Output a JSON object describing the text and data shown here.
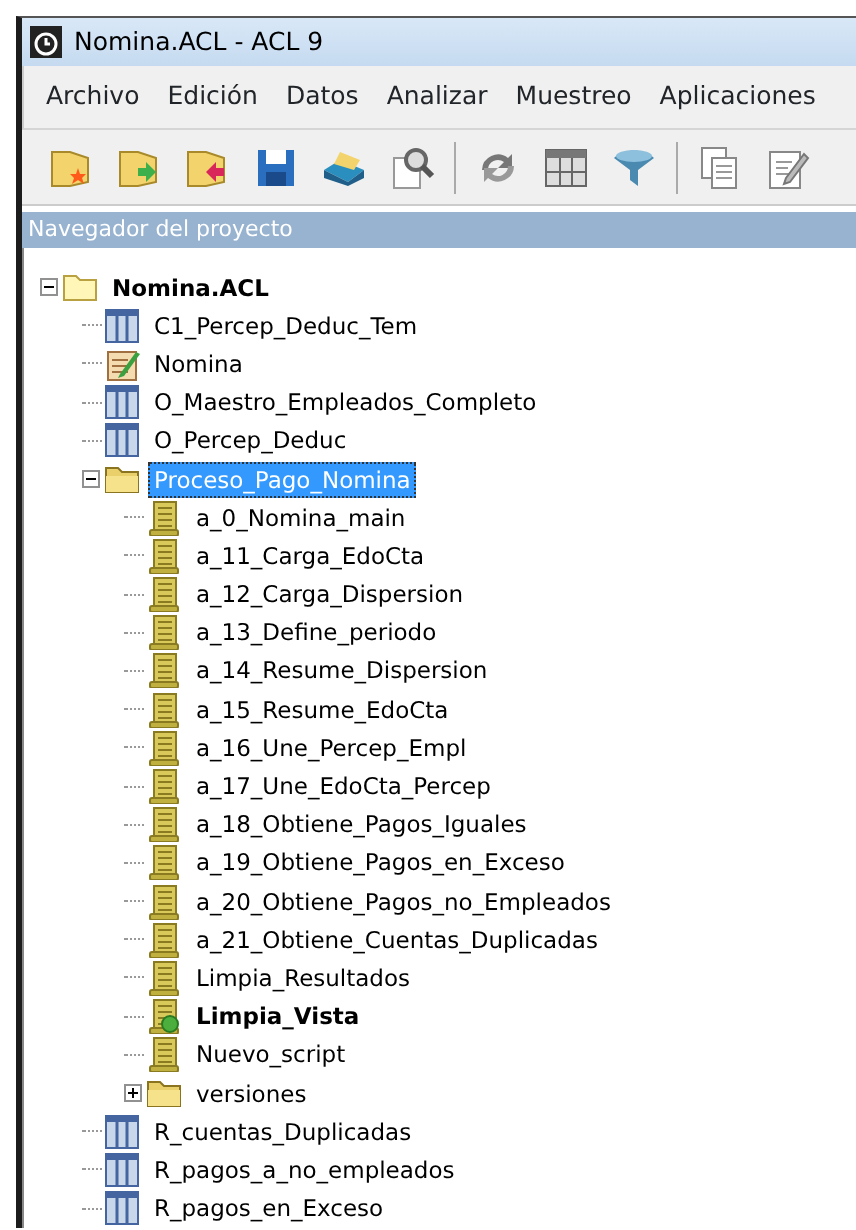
{
  "window": {
    "title": "Nomina.ACL - ACL 9"
  },
  "menu": [
    "Archivo",
    "Edición",
    "Datos",
    "Analizar",
    "Muestreo",
    "Aplicaciones"
  ],
  "toolbar": [
    {
      "kind": "new-project"
    },
    {
      "kind": "open-project"
    },
    {
      "kind": "close-project"
    },
    {
      "kind": "save"
    },
    {
      "kind": "print"
    },
    {
      "kind": "preview"
    },
    {
      "kind": "separator"
    },
    {
      "kind": "refresh"
    },
    {
      "kind": "table"
    },
    {
      "kind": "filter"
    },
    {
      "kind": "separator"
    },
    {
      "kind": "copy"
    },
    {
      "kind": "edit"
    }
  ],
  "navigator": {
    "title": "Navegador del proyecto",
    "tree": [
      {
        "kind": "project",
        "label": "Nomina.ACL",
        "expanded": true,
        "selected": false,
        "children": [
          {
            "kind": "table",
            "label": "C1_Percep_Deduc_Tem",
            "selected": false
          },
          {
            "kind": "workspace",
            "label": "Nomina",
            "selected": false
          },
          {
            "kind": "table",
            "label": "O_Maestro_Empleados_Completo",
            "selected": false
          },
          {
            "kind": "table",
            "label": "O_Percep_Deduc",
            "selected": false
          },
          {
            "kind": "folder",
            "label": "Proceso_Pago_Nomina",
            "expanded": true,
            "selected": true,
            "children": [
              {
                "kind": "script",
                "label": "a_0_Nomina_main",
                "selected": false,
                "startup": false
              },
              {
                "kind": "script",
                "label": "a_11_Carga_EdoCta",
                "selected": false,
                "startup": false
              },
              {
                "kind": "script",
                "label": "a_12_Carga_Dispersion",
                "selected": false,
                "startup": false
              },
              {
                "kind": "script",
                "label": "a_13_Define_periodo",
                "selected": false,
                "startup": false
              },
              {
                "kind": "script",
                "label": "a_14_Resume_Dispersion",
                "selected": false,
                "startup": false
              },
              {
                "kind": "script",
                "label": "a_15_Resume_EdoCta",
                "selected": false,
                "startup": false
              },
              {
                "kind": "script",
                "label": "a_16_Une_Percep_Empl",
                "selected": false,
                "startup": false
              },
              {
                "kind": "script",
                "label": "a_17_Une_EdoCta_Percep",
                "selected": false,
                "startup": false
              },
              {
                "kind": "script",
                "label": "a_18_Obtiene_Pagos_Iguales",
                "selected": false,
                "startup": false
              },
              {
                "kind": "script",
                "label": "a_19_Obtiene_Pagos_en_Exceso",
                "selected": false,
                "startup": false
              },
              {
                "kind": "script",
                "label": "a_20_Obtiene_Pagos_no_Empleados",
                "selected": false,
                "startup": false
              },
              {
                "kind": "script",
                "label": "a_21_Obtiene_Cuentas_Duplicadas",
                "selected": false,
                "startup": false
              },
              {
                "kind": "script",
                "label": "Limpia_Resultados",
                "selected": false,
                "startup": false
              },
              {
                "kind": "script",
                "label": "Limpia_Vista",
                "selected": false,
                "startup": true
              },
              {
                "kind": "script",
                "label": "Nuevo_script",
                "selected": false,
                "startup": false
              },
              {
                "kind": "folder",
                "label": "versiones",
                "expanded": false,
                "selected": false
              }
            ]
          },
          {
            "kind": "table",
            "label": "R_cuentas_Duplicadas",
            "selected": false
          },
          {
            "kind": "table",
            "label": "R_pagos_a_no_empleados",
            "selected": false
          },
          {
            "kind": "table",
            "label": "R_pagos_en_Exceso",
            "selected": false
          }
        ]
      }
    ]
  }
}
